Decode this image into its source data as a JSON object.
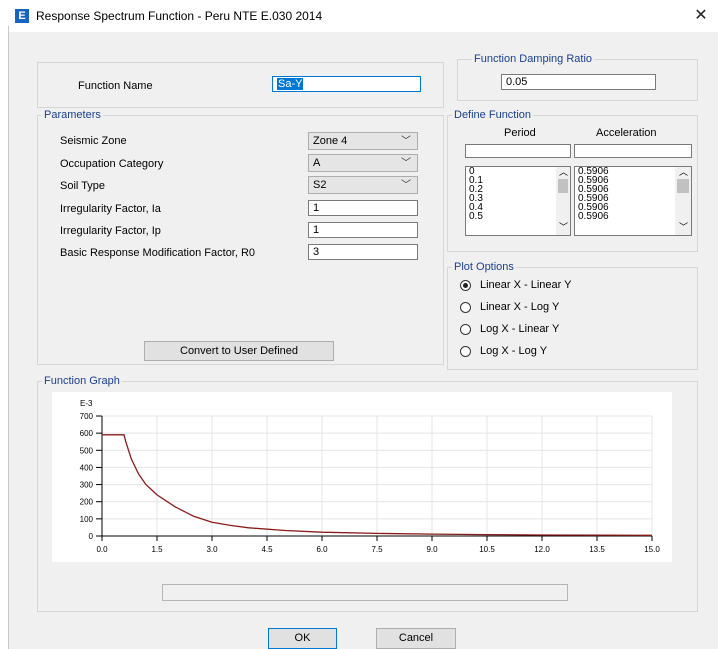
{
  "window": {
    "title": "Response Spectrum Function - Peru NTE E.030 2014",
    "app_icon_letter": "E",
    "close_glyph": "✕"
  },
  "function_name": {
    "label": "Function Name",
    "value": "Sa-Y"
  },
  "damping": {
    "group_label": "Function Damping Ratio",
    "value": "0.05"
  },
  "parameters": {
    "group_label": "Parameters",
    "seismic_zone": {
      "label": "Seismic Zone",
      "value": "Zone 4"
    },
    "occupation_category": {
      "label": "Occupation Category",
      "value": "A"
    },
    "soil_type": {
      "label": "Soil Type",
      "value": "S2"
    },
    "irregularity_ia": {
      "label": "Irregularity Factor, Ia",
      "value": "1"
    },
    "irregularity_ip": {
      "label": "Irregularity Factor, Ip",
      "value": "1"
    },
    "r0": {
      "label": "Basic Response Modification Factor, R0",
      "value": "3"
    },
    "convert_button": "Convert to User Defined"
  },
  "define_function": {
    "group_label": "Define Function",
    "col_period": "Period",
    "col_acceleration": "Acceleration",
    "periods": [
      "0",
      "0.1",
      "0.2",
      "0.3",
      "0.4",
      "0.5"
    ],
    "accelerations": [
      "0.5906",
      "0.5906",
      "0.5906",
      "0.5906",
      "0.5906",
      "0.5906"
    ]
  },
  "plot_options": {
    "group_label": "Plot Options",
    "options": [
      {
        "label": "Linear X - Linear Y",
        "selected": true
      },
      {
        "label": "Linear X - Log Y",
        "selected": false
      },
      {
        "label": "Log X - Linear Y",
        "selected": false
      },
      {
        "label": "Log X - Log Y",
        "selected": false
      }
    ]
  },
  "graph": {
    "group_label": "Function Graph",
    "y_multiplier": "E-3",
    "y_ticks": [
      "700",
      "600",
      "500",
      "400",
      "300",
      "200",
      "100",
      "0"
    ],
    "x_ticks": [
      "0.0",
      "1.5",
      "3.0",
      "4.5",
      "6.0",
      "7.5",
      "9.0",
      "10.5",
      "12.0",
      "13.5",
      "15.0"
    ],
    "curve_color": "#8b1a1a"
  },
  "chart_data": {
    "type": "line",
    "title": "",
    "xlabel": "",
    "ylabel": "E-3",
    "xlim": [
      0,
      15
    ],
    "ylim": [
      0,
      700
    ],
    "grid": true,
    "series": [
      {
        "x": [
          0,
          0.4,
          0.6,
          0.65,
          0.8,
          1.0,
          1.2,
          1.5,
          2.0,
          2.5,
          3.0,
          3.5,
          4.0,
          5.0,
          6.0,
          7.5,
          9.0,
          10.5,
          12.0,
          13.5,
          15.0
        ],
        "values": [
          590.6,
          590.6,
          590.6,
          550,
          450,
          360,
          300,
          240,
          170,
          115,
          80,
          62,
          48,
          32,
          22,
          15,
          11,
          8,
          6,
          5,
          4
        ]
      }
    ]
  },
  "buttons": {
    "ok": "OK",
    "cancel": "Cancel"
  }
}
